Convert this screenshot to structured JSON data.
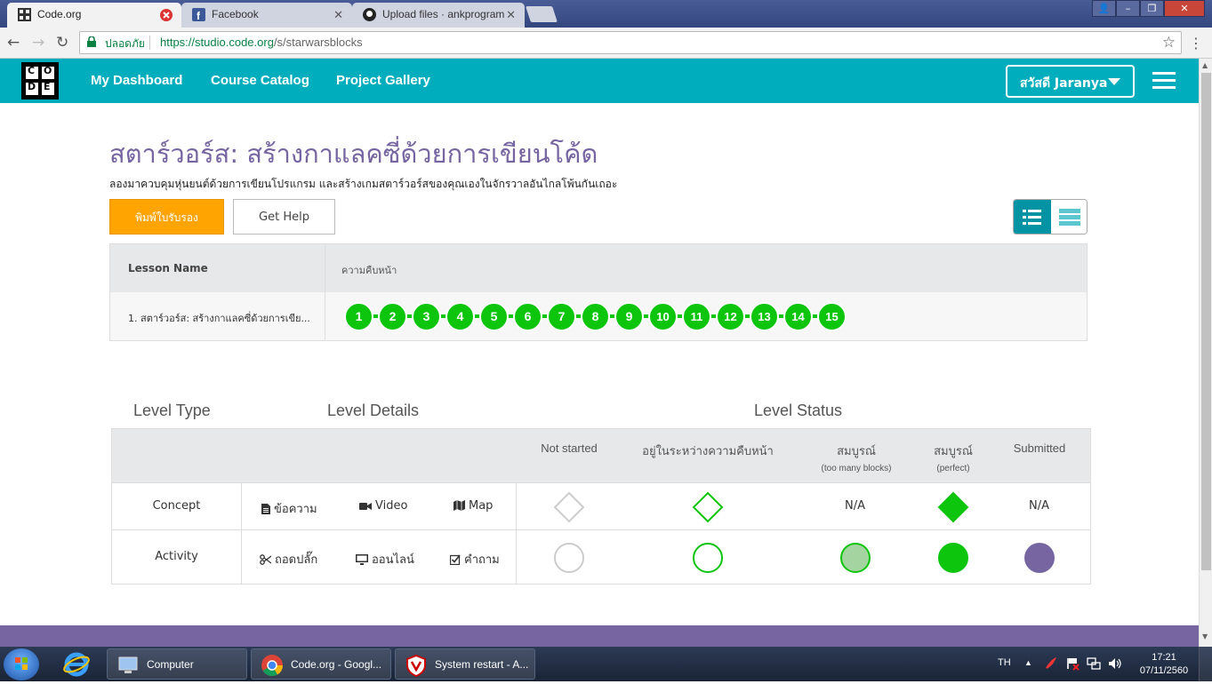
{
  "browser": {
    "tabs": [
      {
        "title": "Code.org",
        "active": true
      },
      {
        "title": "Facebook",
        "active": false
      },
      {
        "title": "Upload files · ankprogram",
        "active": false
      }
    ],
    "secure_label": "ปลอดภัย",
    "url_scheme": "https://",
    "url_host": "studio.code.org",
    "url_path": "/s/starwarsblocks"
  },
  "header": {
    "logo_letters": [
      "C",
      "O",
      "D",
      "E"
    ],
    "nav": [
      "My Dashboard",
      "Course Catalog",
      "Project Gallery"
    ],
    "user_label": "สวัสดี Jaranya",
    "accent_color": "#00adbc"
  },
  "main": {
    "title": "สตาร์วอร์ส: สร้างกาแลคซี่ด้วยการเขียนโค้ด",
    "description": "ลองมาควบคุมหุ่นยนต์ด้วยการเขียนโปรแกรม และสร้างเกมสตาร์วอร์สของคุณเองในจักรวาลอันไกลโพ้นกันเถอะ",
    "certificate_button": "พิมพ์ใบรับรอง",
    "help_button": "Get Help",
    "progress_table": {
      "headers": [
        "Lesson Name",
        "ความคืบหน้า"
      ],
      "rows": [
        {
          "lesson": "1. สตาร์วอร์ส: สร้างกาแลคซี่ด้วยการเขีย...",
          "levels": [
            "1",
            "2",
            "3",
            "4",
            "5",
            "6",
            "7",
            "8",
            "9",
            "10",
            "11",
            "12",
            "13",
            "14",
            "15"
          ]
        }
      ]
    }
  },
  "legend": {
    "headings": [
      "Level Type",
      "Level Details",
      "Level Status"
    ],
    "status_columns": [
      {
        "label": "Not started",
        "sub": ""
      },
      {
        "label": "อยู่ในระหว่างความคืบหน้า",
        "sub": ""
      },
      {
        "label": "สมบูรณ์",
        "sub": "(too many blocks)"
      },
      {
        "label": "สมบูรณ์",
        "sub": "(perfect)"
      },
      {
        "label": "Submitted",
        "sub": ""
      }
    ],
    "rows": [
      {
        "type": "Concept",
        "details": [
          {
            "icon": "document-icon",
            "label": "ข้อความ"
          },
          {
            "icon": "video-icon",
            "label": "Video"
          },
          {
            "icon": "map-icon",
            "label": "Map"
          }
        ],
        "na_too_many": "N/A",
        "na_submitted": "N/A"
      },
      {
        "type": "Activity",
        "details": [
          {
            "icon": "scissors-icon",
            "label": "ถอดปลั๊ก"
          },
          {
            "icon": "monitor-icon",
            "label": "ออนไลน์"
          },
          {
            "icon": "checkbox-icon",
            "label": "คำถาม"
          }
        ]
      }
    ],
    "colors": {
      "green": "#0ec50e",
      "light_green": "#a4d4a0",
      "purple": "#7665a0",
      "gray_border": "#cccccc"
    }
  },
  "taskbar": {
    "items": [
      "Computer",
      "Code.org - Googl...",
      "System restart - A..."
    ],
    "language": "TH",
    "time": "17:21",
    "date": "07/11/2560"
  }
}
